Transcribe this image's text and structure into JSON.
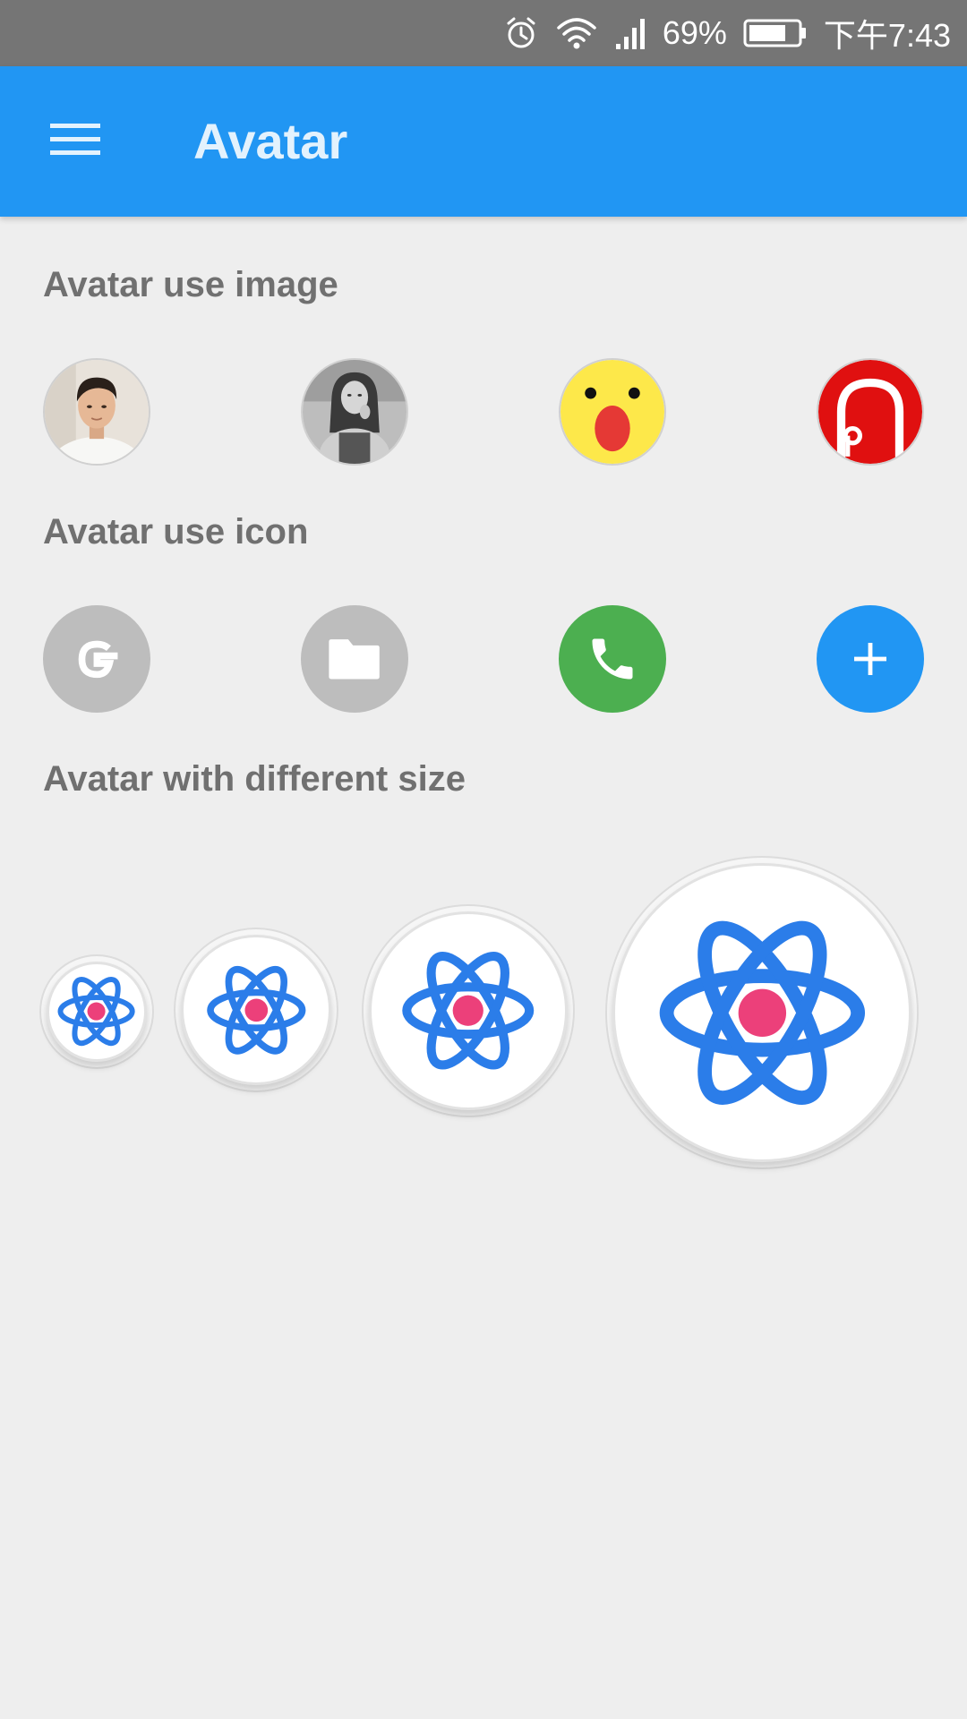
{
  "status_bar": {
    "battery_percent": "69%",
    "time": "下午7:43",
    "icons": [
      "alarm-icon",
      "wifi-icon",
      "signal-icon",
      "battery-icon"
    ]
  },
  "app_bar": {
    "title": "Avatar",
    "menu_icon": "hamburger-menu-icon"
  },
  "sections": {
    "image": {
      "title": "Avatar use image",
      "avatars": [
        "man-portrait-photo",
        "woman-portrait-photo",
        "surprised-emoji",
        "red-p-logo"
      ]
    },
    "icon": {
      "title": "Avatar use icon",
      "avatars": [
        {
          "icon": "google-g-icon",
          "background": "#bdbdbd"
        },
        {
          "icon": "folder-icon",
          "background": "#bdbdbd"
        },
        {
          "icon": "phone-icon",
          "background": "#4caf50"
        },
        {
          "icon": "plus-icon",
          "background": "#2196f3"
        }
      ]
    },
    "size": {
      "title": "Avatar with different size",
      "avatars": [
        "atom-logo-small",
        "atom-logo-medium",
        "atom-logo-large",
        "atom-logo-xlarge"
      ]
    }
  },
  "colors": {
    "status_bar": "#757575",
    "app_bar": "#2196f3",
    "background": "#eeeeee",
    "section_title": "#707070",
    "atom_blue": "#2b7de9",
    "atom_pink": "#ec407a"
  }
}
